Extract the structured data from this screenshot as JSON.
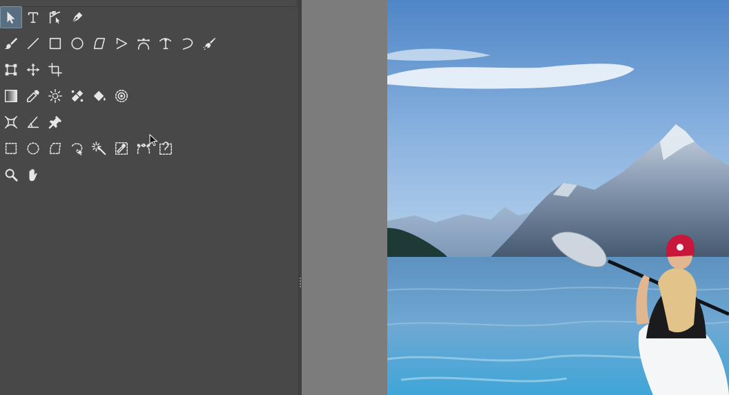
{
  "app": {
    "panel_color": "#484848",
    "canvas_bg_color": "#7c7c7c",
    "active_tool_color": "#5a6e82",
    "icon_color": "#e6e6e6"
  },
  "toolbox": {
    "rows": [
      [
        "pointer-tool-icon",
        "text-tool-icon",
        "path-edit-tool-icon",
        "pen-tool-icon"
      ],
      [
        "brush-tool-icon",
        "line-tool-icon",
        "rectangle-tool-icon",
        "ellipse-tool-icon",
        "polygon-tool-icon",
        "triangle-tool-icon",
        "bezier-tool-icon",
        "curve-node-tool-icon",
        "spiral-tool-icon",
        "spray-tool-icon"
      ],
      [
        "transform-tool-icon",
        "move-tool-icon",
        "crop-tool-icon"
      ],
      [
        "gradient-tool-icon",
        "eyedropper-tool-icon",
        "smart-patch-tool-icon",
        "heal-tool-icon",
        "fill-bucket-tool-icon",
        "clone-tool-icon"
      ],
      [
        "perspective-tool-icon",
        "measure-tool-icon",
        "pin-tool-icon"
      ],
      [
        "rect-select-tool-icon",
        "ellipse-select-tool-icon",
        "polygon-select-tool-icon",
        "freehand-select-tool-icon",
        "magic-wand-tool-icon",
        "color-select-tool-icon",
        "path-select-tool-icon",
        "lasso-select-tool-icon"
      ],
      [
        "zoom-tool-icon",
        "pan-tool-icon"
      ]
    ],
    "active_tool": "pointer-tool-icon"
  },
  "canvas": {
    "image_subject": "woman-in-kayak-on-mountain-lake"
  }
}
